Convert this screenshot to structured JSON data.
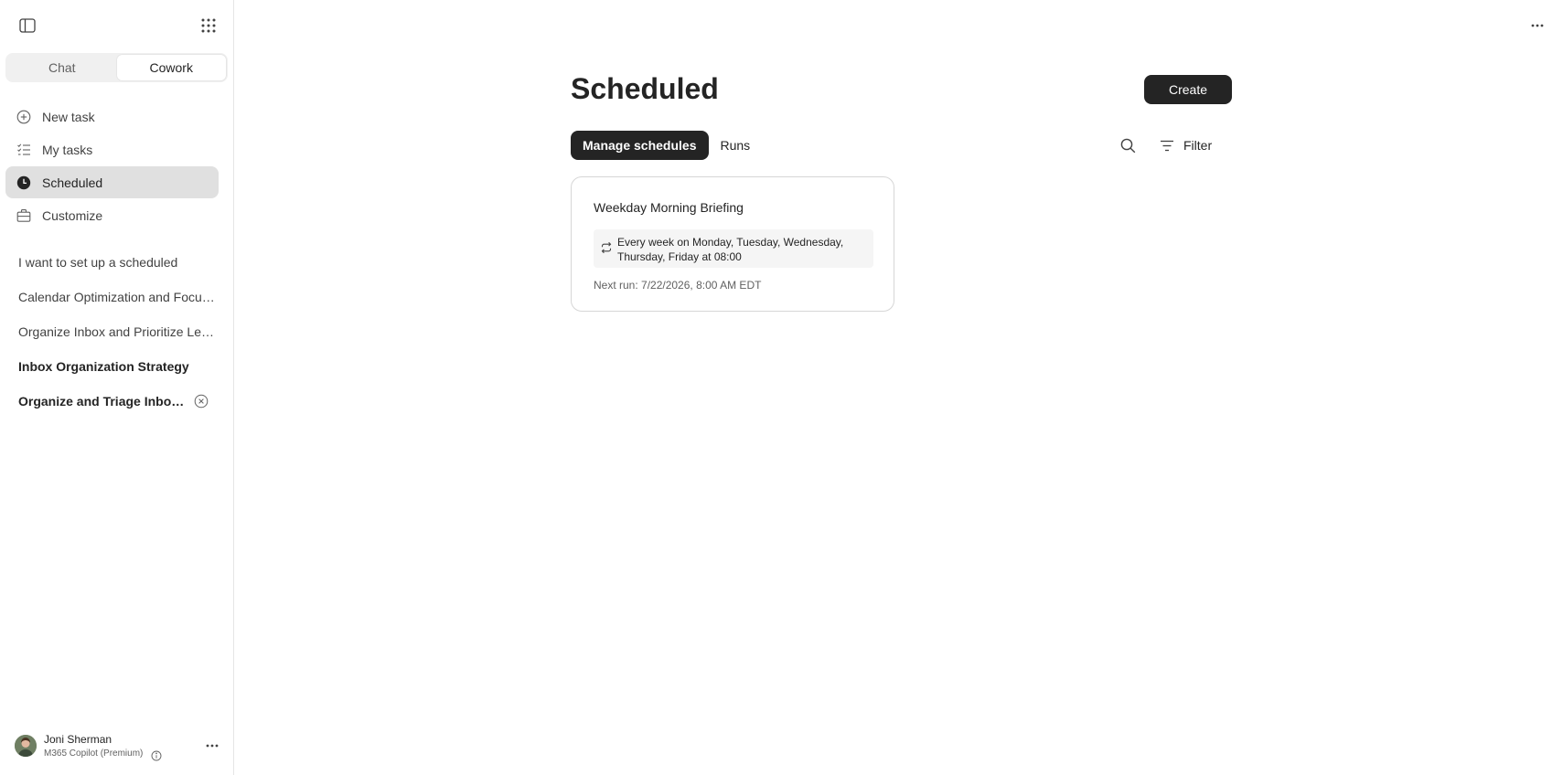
{
  "app": {
    "mode_tabs": [
      {
        "label": "Chat"
      },
      {
        "label": "Cowork"
      }
    ],
    "active_mode": "Cowork"
  },
  "nav": {
    "items": [
      {
        "label": "New task",
        "icon": "plus-circle-icon"
      },
      {
        "label": "My tasks",
        "icon": "task-list-icon"
      },
      {
        "label": "Scheduled",
        "icon": "clock-icon"
      },
      {
        "label": "Customize",
        "icon": "briefcase-icon"
      }
    ],
    "active": "Scheduled"
  },
  "history": {
    "items": [
      {
        "label": "I want to set up a scheduled"
      },
      {
        "label": "Calendar Optimization and Focus Time"
      },
      {
        "label": "Organize Inbox and Prioritize Leads"
      },
      {
        "label": "Inbox Organization Strategy"
      },
      {
        "label": "Organize and Triage Inbox Emails"
      }
    ]
  },
  "user": {
    "name": "Joni Sherman",
    "plan": "M365 Copilot (Premium)"
  },
  "main": {
    "title": "Scheduled",
    "create_label": "Create",
    "tabs": [
      {
        "label": "Manage schedules"
      },
      {
        "label": "Runs"
      }
    ],
    "filter_label": "Filter"
  },
  "schedules": [
    {
      "title": "Weekday Morning Briefing",
      "recurrence": "Every week on Monday, Tuesday, Wednesday, Thursday, Friday at 08:00",
      "next_run": "Next run: 7/22/2026, 8:00 AM EDT"
    }
  ],
  "colors": {
    "accent": "#242424",
    "active_nav_bg": "#e0e0e0",
    "segment_bg": "#f0f0f0"
  }
}
